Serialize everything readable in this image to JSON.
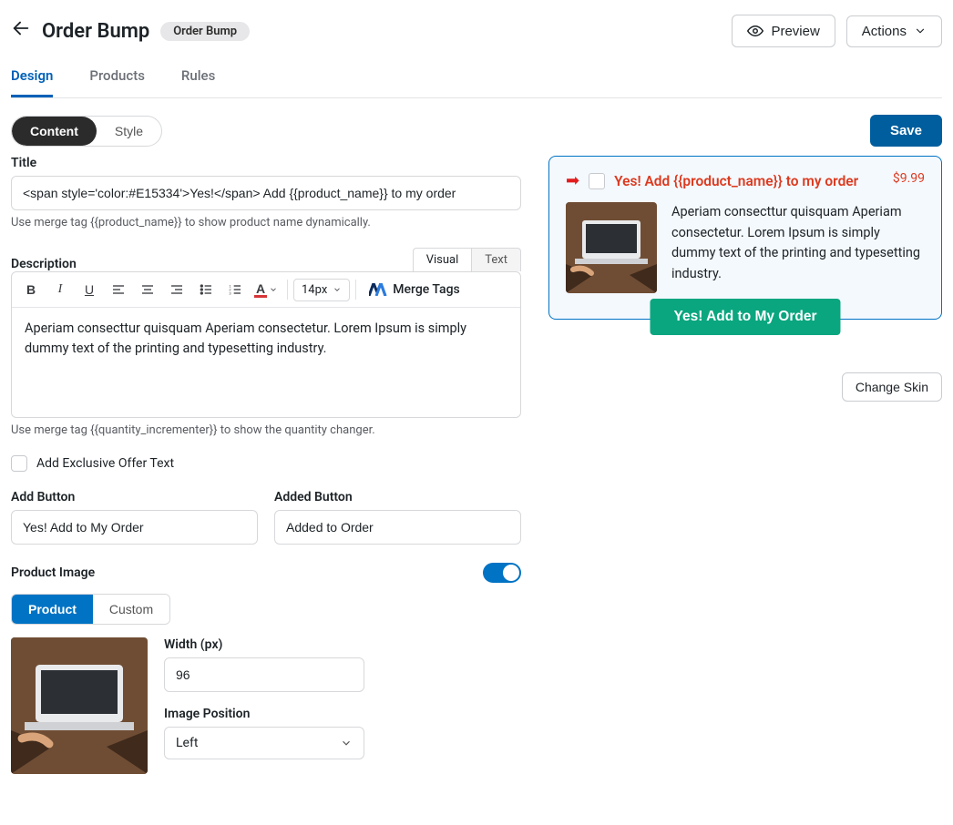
{
  "header": {
    "page_title": "Order Bump",
    "badge": "Order Bump",
    "preview_label": "Preview",
    "actions_label": "Actions"
  },
  "tabs": {
    "items": [
      {
        "label": "Design",
        "active": true
      },
      {
        "label": "Products",
        "active": false
      },
      {
        "label": "Rules",
        "active": false
      }
    ]
  },
  "sub_toggle": {
    "content_label": "Content",
    "style_label": "Style"
  },
  "save_label": "Save",
  "form": {
    "title_label": "Title",
    "title_value": "<span style='color:#E15334'>Yes!</span> Add {{product_name}} to my order",
    "title_help": "Use merge tag {{product_name}} to show product name dynamically.",
    "description_label": "Description",
    "editor_tabs": {
      "visual": "Visual",
      "text": "Text"
    },
    "font_size_value": "14px",
    "merge_tags_label": "Merge Tags",
    "description_value": "Aperiam consecttur quisquam Aperiam consectetur. Lorem Ipsum is simply dummy text of the printing and typesetting industry.",
    "description_help": "Use merge tag {{quantity_incrementer}} to show the quantity changer.",
    "exclusive_offer_label": "Add Exclusive Offer Text",
    "add_button_label": "Add Button",
    "add_button_value": "Yes! Add to My Order",
    "added_button_label": "Added Button",
    "added_button_value": "Added to Order",
    "product_image_label": "Product Image",
    "image_source": {
      "product": "Product",
      "custom": "Custom"
    },
    "width_label": "Width (px)",
    "width_value": "96",
    "image_position_label": "Image Position",
    "image_position_value": "Left"
  },
  "preview": {
    "title_plain": "Yes! Add {{product_name}} to my order",
    "price": "$9.99",
    "description": "Aperiam consecttur quisquam Aperiam consectetur. Lorem Ipsum is simply dummy text of the printing and typesetting industry.",
    "button_label": "Yes! Add to My Order",
    "change_skin_label": "Change Skin"
  }
}
